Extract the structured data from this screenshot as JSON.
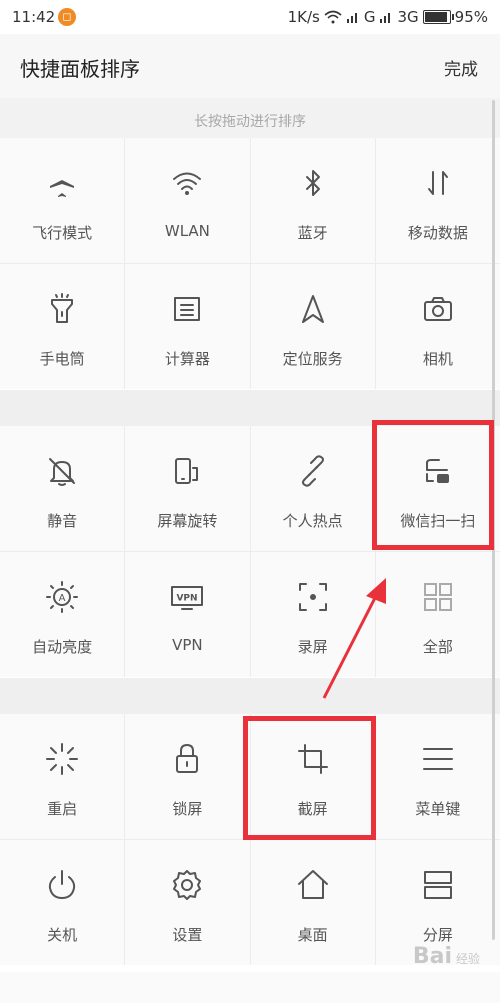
{
  "status": {
    "time": "11:42",
    "speed": "1K/s",
    "net1": "G",
    "net2": "3G",
    "battery": "95%"
  },
  "header": {
    "title": "快捷面板排序",
    "done": "完成"
  },
  "hint": "长按拖动进行排序",
  "group1": [
    {
      "label": "飞行模式",
      "icon": "airplane-icon"
    },
    {
      "label": "WLAN",
      "icon": "wifi-icon"
    },
    {
      "label": "蓝牙",
      "icon": "bluetooth-icon"
    },
    {
      "label": "移动数据",
      "icon": "mobile-data-icon"
    },
    {
      "label": "手电筒",
      "icon": "flashlight-icon"
    },
    {
      "label": "计算器",
      "icon": "calculator-icon"
    },
    {
      "label": "定位服务",
      "icon": "location-icon"
    },
    {
      "label": "相机",
      "icon": "camera-icon"
    }
  ],
  "group2": [
    {
      "label": "静音",
      "icon": "mute-icon"
    },
    {
      "label": "屏幕旋转",
      "icon": "rotate-icon"
    },
    {
      "label": "个人热点",
      "icon": "hotspot-icon"
    },
    {
      "label": "微信扫一扫",
      "icon": "scan-icon"
    },
    {
      "label": "自动亮度",
      "icon": "auto-brightness-icon"
    },
    {
      "label": "VPN",
      "icon": "vpn-icon"
    },
    {
      "label": "录屏",
      "icon": "screen-record-icon"
    },
    {
      "label": "全部",
      "icon": "grid-icon"
    }
  ],
  "group3": [
    {
      "label": "重启",
      "icon": "reboot-icon"
    },
    {
      "label": "锁屏",
      "icon": "lock-icon"
    },
    {
      "label": "截屏",
      "icon": "crop-icon"
    },
    {
      "label": "菜单键",
      "icon": "menu-icon"
    },
    {
      "label": "关机",
      "icon": "power-icon"
    },
    {
      "label": "设置",
      "icon": "settings-icon"
    },
    {
      "label": "桌面",
      "icon": "home-icon"
    },
    {
      "label": "分屏",
      "icon": "split-screen-icon"
    }
  ],
  "watermark": {
    "text": "Bai",
    "sub": "经验"
  },
  "colors": {
    "highlight": "#e8313a",
    "icon": "#555555",
    "notif": "#f08a24"
  }
}
